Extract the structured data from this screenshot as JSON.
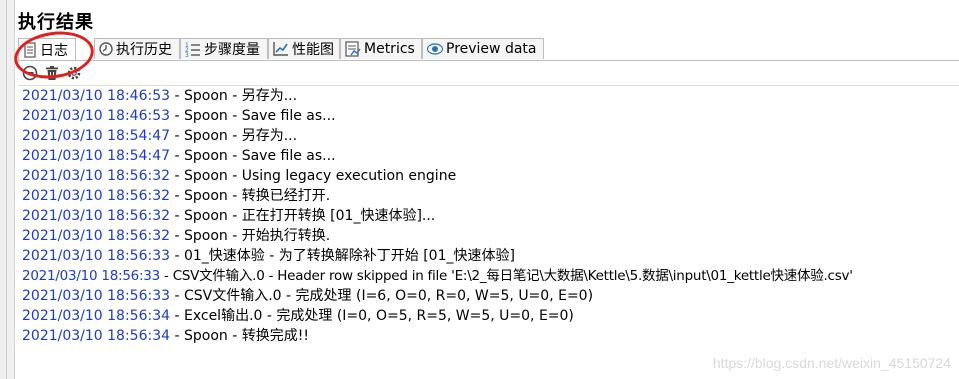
{
  "panel": {
    "title": "执行结果"
  },
  "tabs": [
    {
      "label": "日志",
      "icon": "document-icon"
    },
    {
      "label": "执行历史",
      "icon": "history-icon"
    },
    {
      "label": "步骤度量",
      "icon": "list-metrics-icon"
    },
    {
      "label": "性能图",
      "icon": "chart-icon"
    },
    {
      "label": "Metrics",
      "icon": "metrics-icon"
    },
    {
      "label": "Preview data",
      "icon": "eye-icon"
    }
  ],
  "toolbar": {
    "icons": [
      "stop-icon",
      "trash-icon",
      "settings-icon"
    ]
  },
  "log": [
    {
      "ts": "2021/03/10 18:46:53",
      "msg": " - Spoon - 另存为..."
    },
    {
      "ts": "2021/03/10 18:46:53",
      "msg": " - Spoon - Save file as..."
    },
    {
      "ts": "2021/03/10 18:54:47",
      "msg": " - Spoon - 另存为..."
    },
    {
      "ts": "2021/03/10 18:54:47",
      "msg": " - Spoon - Save file as..."
    },
    {
      "ts": "2021/03/10 18:56:32",
      "msg": " - Spoon - Using legacy execution engine"
    },
    {
      "ts": "2021/03/10 18:56:32",
      "msg": " - Spoon - 转换已经打开."
    },
    {
      "ts": "2021/03/10 18:56:32",
      "msg": " - Spoon - 正在打开转换 [01_快速体验]..."
    },
    {
      "ts": "2021/03/10 18:56:32",
      "msg": " - Spoon - 开始执行转换."
    },
    {
      "ts": "2021/03/10 18:56:33",
      "msg": " - 01_快速体验 - 为了转换解除补丁开始  [01_快速体验]"
    },
    {
      "ts": "2021/03/10 18:56:33",
      "msg": " - CSV文件输入.0 - Header row skipped in file 'E:\\2_每日笔记\\大数据\\Kettle\\5.数据\\input\\01_kettle快速体验.csv'"
    },
    {
      "ts": "2021/03/10 18:56:33",
      "msg": " - CSV文件输入.0 - 完成处理 (I=6, O=0, R=0, W=5, U=0, E=0)"
    },
    {
      "ts": "2021/03/10 18:56:34",
      "msg": " - Excel输出.0 - 完成处理 (I=0, O=5, R=5, W=5, U=0, E=0)"
    },
    {
      "ts": "2021/03/10 18:56:34",
      "msg": " - Spoon - 转换完成!!"
    }
  ],
  "watermark": "https://blog.csdn.net/weixin_45150724",
  "colors": {
    "timestamp": "#1a3cc8",
    "annotation": "#e02020"
  }
}
